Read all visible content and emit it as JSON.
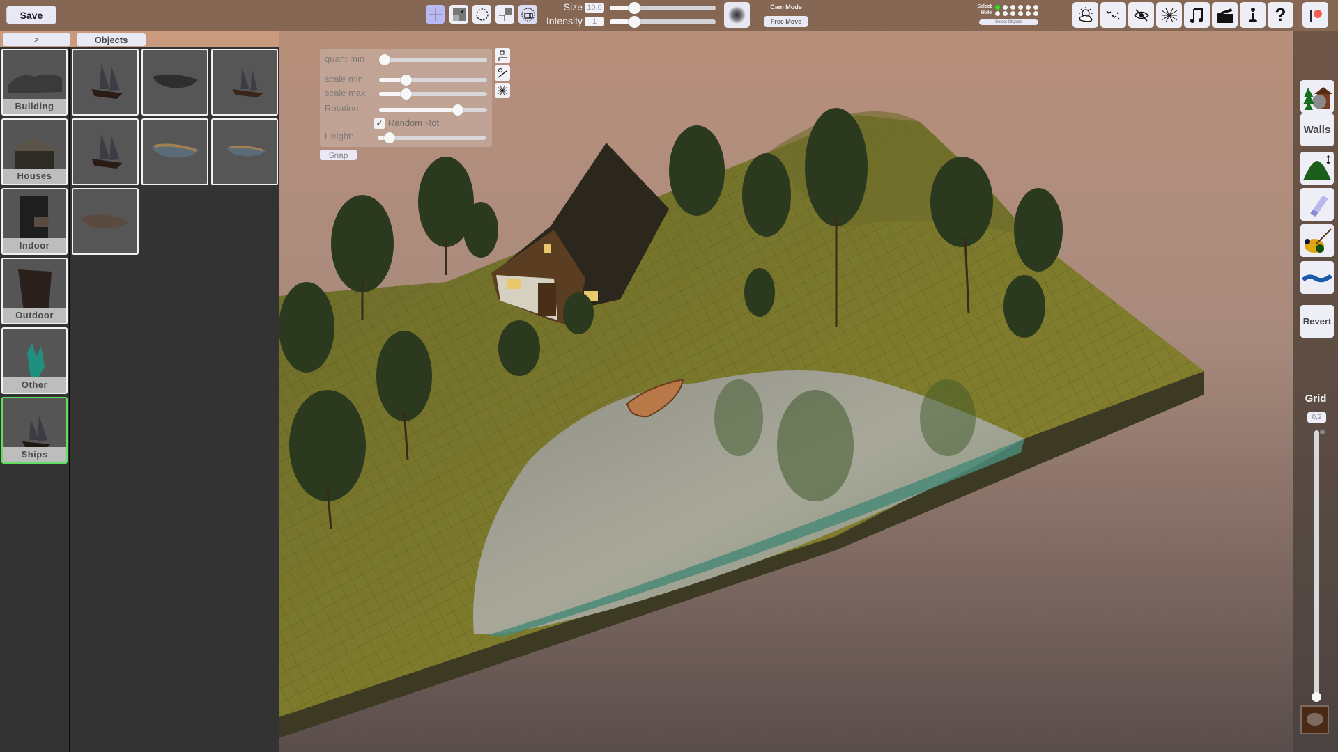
{
  "toolbar": {
    "save_label": "Save",
    "transform_tools": [
      {
        "name": "move-tool",
        "icon": "move-arrows-icon",
        "active": true
      },
      {
        "name": "scale-tool",
        "icon": "scale-icon",
        "active": false
      },
      {
        "name": "rotate-tool",
        "icon": "rotate-icon",
        "active": false
      },
      {
        "name": "pivot-tool",
        "icon": "pivot-scale-icon",
        "active": false
      },
      {
        "name": "group-tool",
        "icon": "group-select-icon",
        "active": true
      }
    ],
    "size_label": "Size",
    "size_value": "10,0",
    "size_fraction": 0.18,
    "intensity_label": "Intensity",
    "intensity_value": "1",
    "intensity_fraction": 0.18,
    "cam_mode_label": "Cam Mode",
    "cam_mode_value": "Free Move",
    "select_label": "Select",
    "hide_label": "Hide",
    "select_layers": [
      true,
      false,
      false,
      false,
      false,
      false
    ],
    "hide_layers": [
      false,
      false,
      false,
      false,
      false,
      false
    ],
    "select_objects_label": "Select Objects",
    "icon_buttons": [
      {
        "name": "weather-button",
        "icon": "weather-sun-cloud-icon"
      },
      {
        "name": "birds-button",
        "icon": "birds-icon"
      },
      {
        "name": "visibility-button",
        "icon": "eye-hidden-icon"
      },
      {
        "name": "grid-mesh-button",
        "icon": "mesh-icon"
      },
      {
        "name": "music-button",
        "icon": "music-note-icon"
      },
      {
        "name": "cinematic-button",
        "icon": "clapperboard-icon"
      },
      {
        "name": "character-button",
        "icon": "pawn-icon"
      },
      {
        "name": "help-button",
        "icon": "help-icon"
      },
      {
        "name": "patreon-button",
        "icon": "patreon-icon"
      }
    ]
  },
  "left_panel": {
    "toggle_label": ">",
    "tab_label": "Objects",
    "categories": [
      {
        "label": "Building",
        "selected": false
      },
      {
        "label": "Houses",
        "selected": false
      },
      {
        "label": "Indoor",
        "selected": false
      },
      {
        "label": "Outdoor",
        "selected": false
      },
      {
        "label": "Other",
        "selected": false
      },
      {
        "label": "Ships",
        "selected": true
      }
    ],
    "objects": [
      {
        "kind": "galleon"
      },
      {
        "kind": "dark-rowboat"
      },
      {
        "kind": "brig"
      },
      {
        "kind": "galleon"
      },
      {
        "kind": "blue-rowboat"
      },
      {
        "kind": "small-rowboat"
      },
      {
        "kind": "wooden-boat"
      }
    ]
  },
  "brush_panel": {
    "quant_min_label": "quant min",
    "quant_min": 0.0,
    "scale_min_label": "scale min",
    "scale_min": 0.2,
    "scale_max_label": "scale max",
    "scale_max": 0.2,
    "rotation_label": "Rotation",
    "rotation": 0.68,
    "random_rot_label": "Random Rot",
    "random_rot_checked": true,
    "height_label": "Height:",
    "height": 0.06,
    "snap_label": "Snap",
    "side_tools": [
      "place-single-icon",
      "paint-line-icon",
      "scatter-icon"
    ]
  },
  "right_panel": {
    "tools": [
      {
        "name": "objects-tool",
        "icon": "tree-house-icon",
        "label": ""
      },
      {
        "name": "walls-tool",
        "icon": "",
        "label": "Walls"
      },
      {
        "name": "terrain-height-tool",
        "icon": "hill-height-icon",
        "label": ""
      },
      {
        "name": "eraser-tool",
        "icon": "eraser-icon",
        "label": ""
      },
      {
        "name": "paint-tool",
        "icon": "paint-palette-icon",
        "label": ""
      },
      {
        "name": "water-tool",
        "icon": "water-wave-icon",
        "label": ""
      },
      {
        "name": "revert-tool",
        "icon": "",
        "label": "Revert"
      }
    ],
    "grid_label": "Grid",
    "grid_value": "0,2",
    "grid_slider_fraction": 0.0,
    "chat_icon": "chat-bubble-icon"
  }
}
